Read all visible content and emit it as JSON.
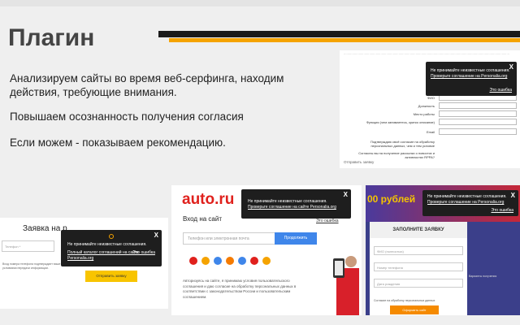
{
  "heading": {
    "title": "Плагин",
    "paragraphs": [
      "Анализируем сайты во время веб-серфинга, находим действия, требующие внимания.",
      "Повышаем осознанность получения согласия",
      "Если можем - показываем рекомендацию."
    ]
  },
  "colors": {
    "accent_orange": "#f5a300",
    "dark_bar": "#1b1b1b",
    "autoru_red": "#e0211d",
    "button_blue": "#3f86ea",
    "button_yellow": "#f8c400"
  },
  "shot_a": {
    "labels": [
      "ФИО",
      "Должность",
      "Место работы",
      "Функция (чем занимаетесь, кратко описание)",
      "Email",
      "Подтверждаю своё согласие на обработку персональных данных, чем и тем условие",
      "Согласны вы на получение рассылки о новостях и активностях RPPA?"
    ],
    "send": "Отправить заявку",
    "popup": {
      "line1": "Не принимайте неизвестные соглашения.",
      "line2": "Проверьте соглашение на Personalia.org",
      "error": "Это ошибка",
      "close": "X"
    }
  },
  "shot_b": {
    "heading": "Заявка на р",
    "tel_placeholder": "Телефон *",
    "note": "Вход номера телефона подтверждает ваше согласие с условиями передачи информации.",
    "button": "Отправить заявку",
    "popup": {
      "line1": "Не принимайте неизвестные соглашения.",
      "line2": "Полный каталог соглашений на сайте Personalia.org",
      "error": "Это ошибка",
      "close": "X"
    }
  },
  "shot_c": {
    "logo": "auto.ru",
    "enter": "Вход на сайт",
    "error_link": "Это ошибка",
    "phone_placeholder": "Телефон или электронная почта",
    "continue": "Продолжить",
    "terms_text": "Авторизуясь на сайте, я принимаю условия пользовательского соглашения и даю согласие на обработку персональных данных в соответствии с законодательством России и пользовательским соглашением.",
    "popup": {
      "line1": "Не принимайте неизвестные соглашения.",
      "line2": "Проверьте соглашение на сайте Personalia.org",
      "close": "X"
    },
    "social_colors": [
      "#e0211d",
      "#f5a300",
      "#3f86ea",
      "#f57b00",
      "#3f86ea",
      "#e0211d",
      "#f5a300"
    ]
  },
  "shot_d": {
    "banner": "00 рублей",
    "form_title": "ЗАПОЛНИТЕ ЗАЯВКУ",
    "fields": [
      "ФИО (полностью)",
      "Номер телефона",
      "Дата рождения"
    ],
    "checkbox": "Согласие на обработку персональных данных",
    "button": "Оформить сайт",
    "side": [
      "Варианты получения"
    ],
    "popup": {
      "line1": "Не принимайте неизвестные соглашения.",
      "line2": "Проверьте соглашение на Personalia.org",
      "error": "Это ошибка",
      "close": "X"
    }
  }
}
